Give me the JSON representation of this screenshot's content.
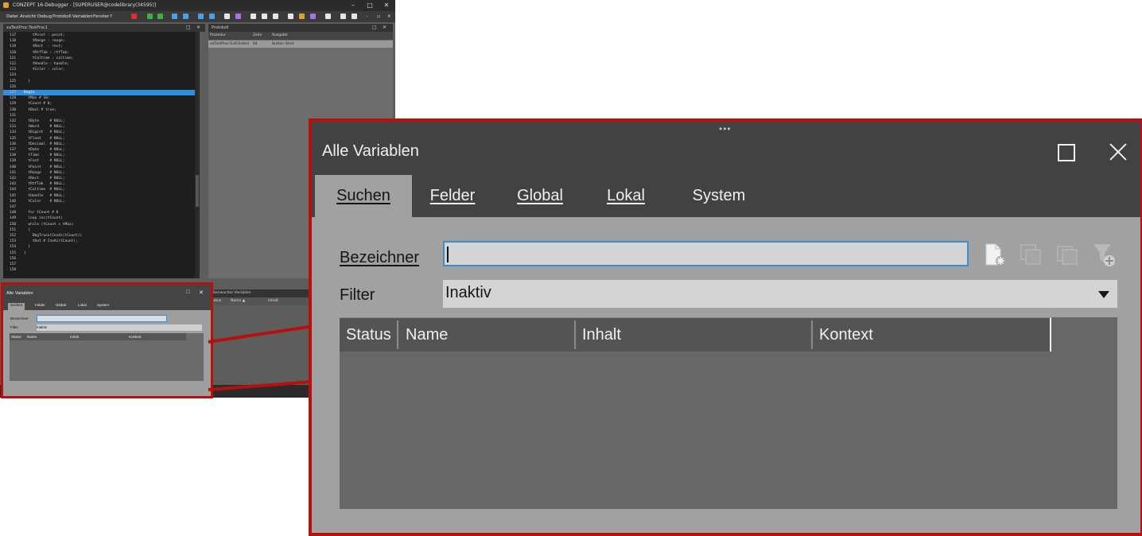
{
  "ide": {
    "title": "CONZEPT 16-Debugger - [SUPERUSER@codelibrary(34595)]",
    "menu": [
      "Datei",
      "Ansicht",
      "Debug",
      "Protokoll",
      "Variablen",
      "Fenster",
      "?"
    ],
    "editor_title": "xaTestProc:TestProc1",
    "protokoll_title": "Protokoll",
    "protokoll_columns": [
      "Prozedur",
      "Zeile",
      "Ausgabe"
    ],
    "protokoll_row": {
      "prozedur": "xaTestProc:EvtClicked",
      "zeile": "84",
      "ausgabe": "Button Start"
    },
    "ueber_title": "Überwachte Variablen",
    "ueber_columns": [
      "Status",
      "Name ▲",
      "Inhalt"
    ],
    "line_numbers": [
      "117",
      "118",
      "119",
      "120",
      "121",
      "122",
      "123",
      "124",
      "125",
      "126",
      "127",
      "128",
      "129",
      "130",
      "131",
      "132",
      "133",
      "134",
      "135",
      "136",
      "137",
      "138",
      "139",
      "140",
      "141",
      "142",
      "143",
      "144",
      "145",
      "146",
      "147",
      "148",
      "149",
      "150",
      "151",
      "152",
      "153",
      "154",
      "155",
      "156",
      "157",
      "158"
    ],
    "code_lines": [
      "    tPoint : point;",
      "    tRange : range;",
      "    tRect  : rect;",
      "    tRtfTab : rtfTab;",
      "    tCaltime : caltime;",
      "    tHandle : handle;",
      "    tColor : color;",
      "",
      "  }",
      "",
      "Begin",
      "  tMax # 10;",
      "  tCount # 0;",
      "  tBool # true;",
      "",
      "  tByte     # NULL;",
      "  tWord     # NULL;",
      "  tBigint   # NULL;",
      "  tFloat    # NULL;",
      "  tDecimal  # NULL;",
      "  tDate     # NULL;",
      "  tTime     # NULL;",
      "  tFont     # NULL;",
      "  tPoint    # NULL;",
      "  tRange    # NULL;",
      "  tRect     # NULL;",
      "  tRtfTab   # NULL;",
      "  tCaltime  # NULL;",
      "  tHandle   # NULL;",
      "  tColor    # NULL;",
      "",
      "  for tCount # 0",
      "  loop inc(tCount)",
      "  while (tCount < tMax)",
      "  {",
      "    DbgTrace(CnvAi(tCount))",
      "    tOut # CnvAi(tCount);",
      "  }",
      "}",
      "",
      "",
      ""
    ]
  },
  "panel": {
    "title": "Alle Variablen",
    "tabs": [
      {
        "label": "Suchen",
        "active": true
      },
      {
        "label": "Felder",
        "active": false
      },
      {
        "label": "Global",
        "active": false
      },
      {
        "label": "Lokal",
        "active": false
      },
      {
        "label": "System",
        "active": false
      }
    ],
    "bezeichner_label": "Bezeichner",
    "bezeichner_value": "",
    "filter_label": "Filter",
    "filter_value": "Inaktiv",
    "columns": [
      "Status",
      "Name",
      "Inhalt",
      "Kontext"
    ],
    "tools": [
      "add-watch-icon",
      "copy-icon",
      "copy-disabled-icon",
      "filter-add-icon"
    ]
  },
  "colors": {
    "highlight_red": "#b80f0f",
    "header_dark": "#424242",
    "panel_gray": "#a1a1a1",
    "focus_blue": "#3b8ed0",
    "editor_bg": "#1e1e1e",
    "selection_blue": "#2e8fe0"
  }
}
